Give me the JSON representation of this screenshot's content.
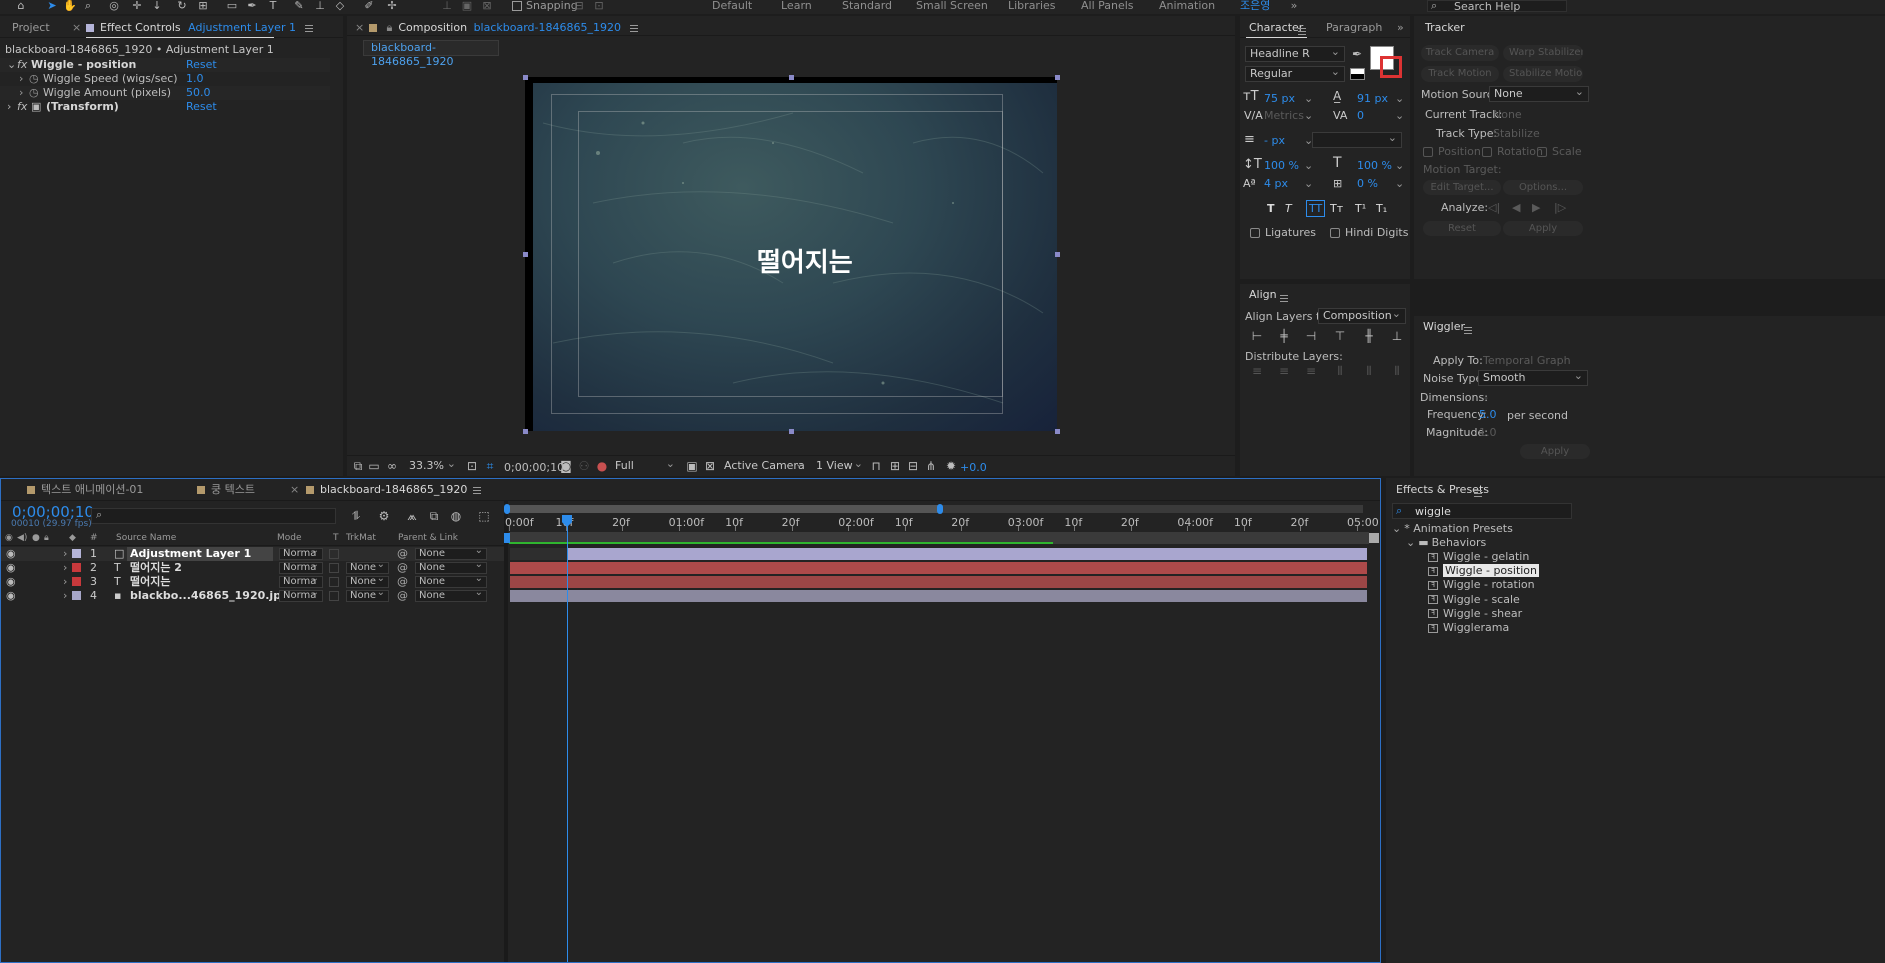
{
  "toolbar": {
    "snapping_label": "Snapping",
    "workspaces": [
      "Default",
      "Learn",
      "Standard",
      "Small Screen",
      "Libraries",
      "All Panels",
      "Animation"
    ],
    "active_workspace": "조은영",
    "search_help": "Search Help"
  },
  "left_panel": {
    "tab_project": "Project",
    "tab_effect_controls": "Effect Controls",
    "tab_effect_target": "Adjustment Layer 1",
    "breadcrumb": "blackboard-1846865_1920 • Adjustment Layer 1",
    "effects": [
      {
        "name": "Wiggle - position",
        "value": "Reset"
      },
      {
        "name": "Wiggle Speed (wigs/sec)",
        "value": "1.0"
      },
      {
        "name": "Wiggle Amount (pixels)",
        "value": "50.0"
      },
      {
        "name": "(Transform)",
        "value": "Reset"
      }
    ]
  },
  "composition": {
    "tab_label": "Composition",
    "tab_name": "blackboard-1846865_1920",
    "sub_tab": "blackboard-1846865_1920",
    "overlay_text": "떨어지는",
    "footer": {
      "zoom": "33.3%",
      "timecode": "0;00;00;10",
      "resolution": "Full",
      "camera": "Active Camera",
      "views": "1 View",
      "exposure": "+0.0"
    }
  },
  "character": {
    "tab_character": "Character",
    "tab_paragraph": "Paragraph",
    "font_family": "Headline R",
    "font_style": "Regular",
    "font_size": "75 px",
    "leading": "91 px",
    "kerning": "Metrics",
    "tracking": "0",
    "stroke_width": "- px",
    "vert_scale": "100 %",
    "horiz_scale": "100 %",
    "baseline_shift": "4 px",
    "tsume": "0 %",
    "ligatures": "Ligatures",
    "hindi_digits": "Hindi Digits",
    "style_buttons": [
      "T",
      "T",
      "TT",
      "Tт",
      "T¹",
      "T₁"
    ]
  },
  "align": {
    "title": "Align",
    "align_to_label": "Align Layers to:",
    "align_to_value": "Composition",
    "distribute_label": "Distribute Layers:"
  },
  "tracker": {
    "title": "Tracker",
    "track_camera": "Track Camera",
    "warp_stabilizer": "Warp Stabilizer",
    "track_motion": "Track Motion",
    "stabilize_motion": "Stabilize Motion",
    "motion_source_label": "Motion Source:",
    "motion_source_value": "None",
    "current_track_label": "Current Track:",
    "current_track_value": "None",
    "track_type_label": "Track Type:",
    "track_type_value": "Stabilize",
    "position": "Position",
    "rotation": "Rotation",
    "scale": "Scale",
    "motion_target": "Motion Target:",
    "edit_target": "Edit Target...",
    "options": "Options...",
    "analyze": "Analyze:",
    "reset": "Reset",
    "apply": "Apply"
  },
  "wiggler": {
    "title": "Wiggler",
    "apply_to_label": "Apply To:",
    "apply_to_value": "Temporal Graph",
    "noise_type_label": "Noise Type:",
    "noise_type_value": "Smooth",
    "dimensions_label": "Dimensions:",
    "dimensions_value": "-",
    "frequency_label": "Frequency:",
    "frequency_value": "5.0",
    "frequency_unit": "per second",
    "magnitude_label": "Magnitude:",
    "magnitude_value": "1.0",
    "apply": "Apply"
  },
  "timeline": {
    "tabs": [
      "텍스트 애니메이션-01",
      "쿵 텍스트",
      "blackboard-1846865_1920"
    ],
    "timecode": "0;00;00;10",
    "timecode_sub": "00010 (29.97 fps)",
    "columns": {
      "hash": "#",
      "source_name": "Source Name",
      "mode": "Mode",
      "t": "T",
      "trkmat": "TrkMat",
      "parent": "Parent & Link"
    },
    "layers": [
      {
        "num": "1",
        "name": "Adjustment Layer 1",
        "mode": "Norma",
        "trkmat": "",
        "parent": "None",
        "label_color": "#b4b4d8",
        "type": "adj"
      },
      {
        "num": "2",
        "name": "떨어지는 2",
        "mode": "Norma",
        "trkmat": "None",
        "parent": "None",
        "label_color": "#c8393c",
        "type": "T"
      },
      {
        "num": "3",
        "name": "떨어지는",
        "mode": "Norma",
        "trkmat": "None",
        "parent": "None",
        "label_color": "#c8393c",
        "type": "T"
      },
      {
        "num": "4",
        "name": "blackbo...46865_1920.jp",
        "mode": "Norma",
        "trkmat": "None",
        "parent": "None",
        "label_color": "#a6a6c8",
        "type": "img"
      }
    ],
    "ruler_labels": [
      "0:00f",
      "10f",
      "20f",
      "01:00f",
      "10f",
      "20f",
      "02:00f",
      "10f",
      "20f",
      "03:00f",
      "10f",
      "20f",
      "04:00f",
      "10f",
      "20f",
      "05:00"
    ]
  },
  "effects_presets": {
    "title": "Effects & Presets",
    "search_value": "wiggle",
    "root": "* Animation Presets",
    "folder": "Behaviors",
    "items": [
      "Wiggle - gelatin",
      "Wiggle - position",
      "Wiggle - rotation",
      "Wiggle - scale",
      "Wiggle - shear",
      "Wigglerama"
    ],
    "selected": "Wiggle - position"
  }
}
